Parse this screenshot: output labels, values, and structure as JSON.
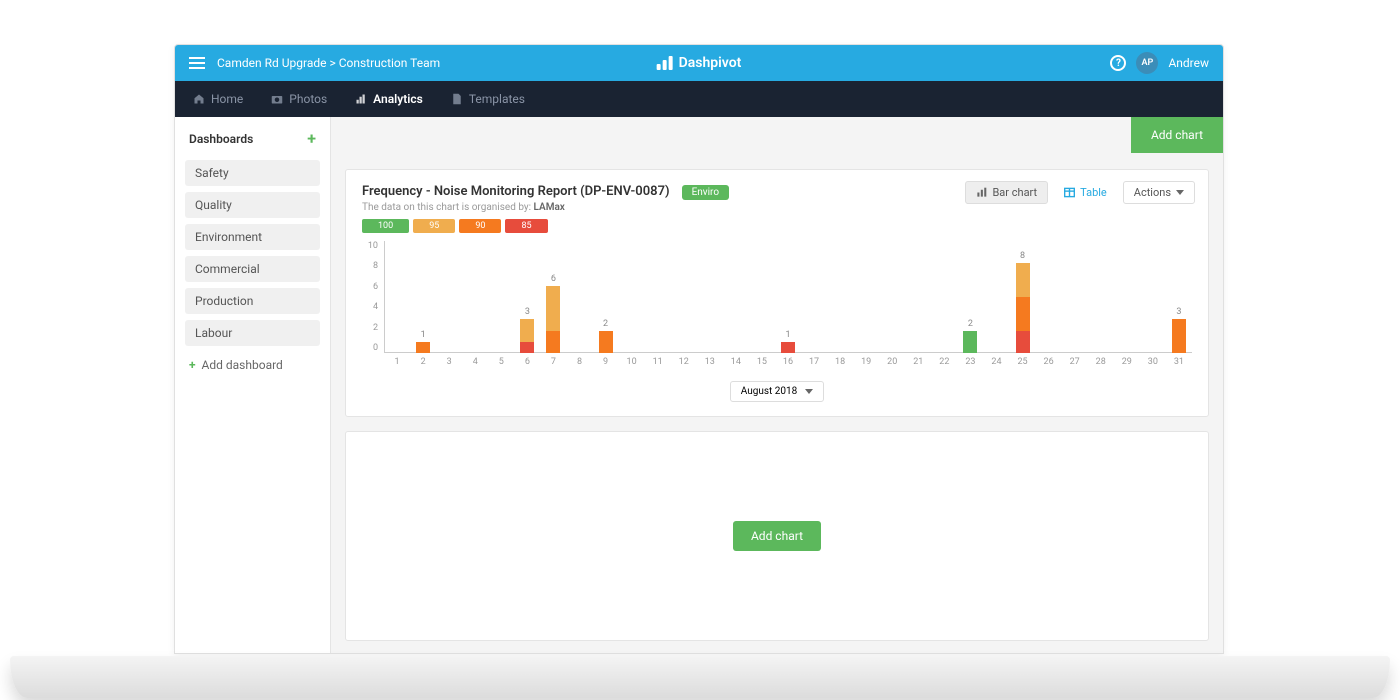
{
  "breadcrumb": "Camden Rd Upgrade > Construction Team",
  "brand": "Dashpivot",
  "user": {
    "initials": "AP",
    "name": "Andrew"
  },
  "nav": {
    "home": "Home",
    "photos": "Photos",
    "analytics": "Analytics",
    "templates": "Templates"
  },
  "sidebar": {
    "title": "Dashboards",
    "items": [
      "Safety",
      "Quality",
      "Environment",
      "Commercial",
      "Production",
      "Labour"
    ],
    "add": "Add dashboard"
  },
  "buttons": {
    "add_chart": "Add chart",
    "bar_chart": "Bar chart",
    "table": "Table",
    "actions": "Actions"
  },
  "card": {
    "title": "Frequency - Noise Monitoring Report (DP-ENV-0087)",
    "badge": "Enviro",
    "sub_prefix": "The data on this chart is organised by: ",
    "sub_value": "LAMax",
    "month": "August 2018"
  },
  "legend": [
    {
      "label": "100",
      "color": "#5cb85c"
    },
    {
      "label": "95",
      "color": "#f0ad4e"
    },
    {
      "label": "90",
      "color": "#f57a1f"
    },
    {
      "label": "85",
      "color": "#e74c3c"
    }
  ],
  "colors": {
    "green": "#5cb85c",
    "yellow": "#f0ad4e",
    "orange": "#f57a1f",
    "red": "#e74c3c"
  },
  "chart_data": {
    "type": "bar",
    "ylabel": "",
    "xlabel": "",
    "ylim": [
      0,
      10
    ],
    "yticks": [
      0,
      2,
      4,
      6,
      8,
      10
    ],
    "categories": [
      1,
      2,
      3,
      4,
      5,
      6,
      7,
      8,
      9,
      10,
      11,
      12,
      13,
      14,
      15,
      16,
      17,
      18,
      19,
      20,
      21,
      22,
      23,
      24,
      25,
      26,
      27,
      28,
      29,
      30,
      31
    ],
    "stacks": [
      "100",
      "95",
      "90",
      "85"
    ],
    "stack_colors": {
      "100": "#5cb85c",
      "95": "#f0ad4e",
      "90": "#f57a1f",
      "85": "#e74c3c"
    },
    "series": [
      {
        "x": 2,
        "total": 1,
        "segments": {
          "90": 1
        }
      },
      {
        "x": 6,
        "total": 3,
        "segments": {
          "95": 2,
          "85": 1
        }
      },
      {
        "x": 7,
        "total": 6,
        "segments": {
          "95": 4,
          "90": 2
        }
      },
      {
        "x": 9,
        "total": 2,
        "segments": {
          "90": 2
        }
      },
      {
        "x": 16,
        "total": 1,
        "segments": {
          "85": 1
        }
      },
      {
        "x": 23,
        "total": 2,
        "segments": {
          "100": 2
        }
      },
      {
        "x": 25,
        "total": 8,
        "segments": {
          "95": 3,
          "90": 3,
          "85": 2
        }
      },
      {
        "x": 31,
        "total": 3,
        "segments": {
          "90": 3
        }
      }
    ]
  }
}
